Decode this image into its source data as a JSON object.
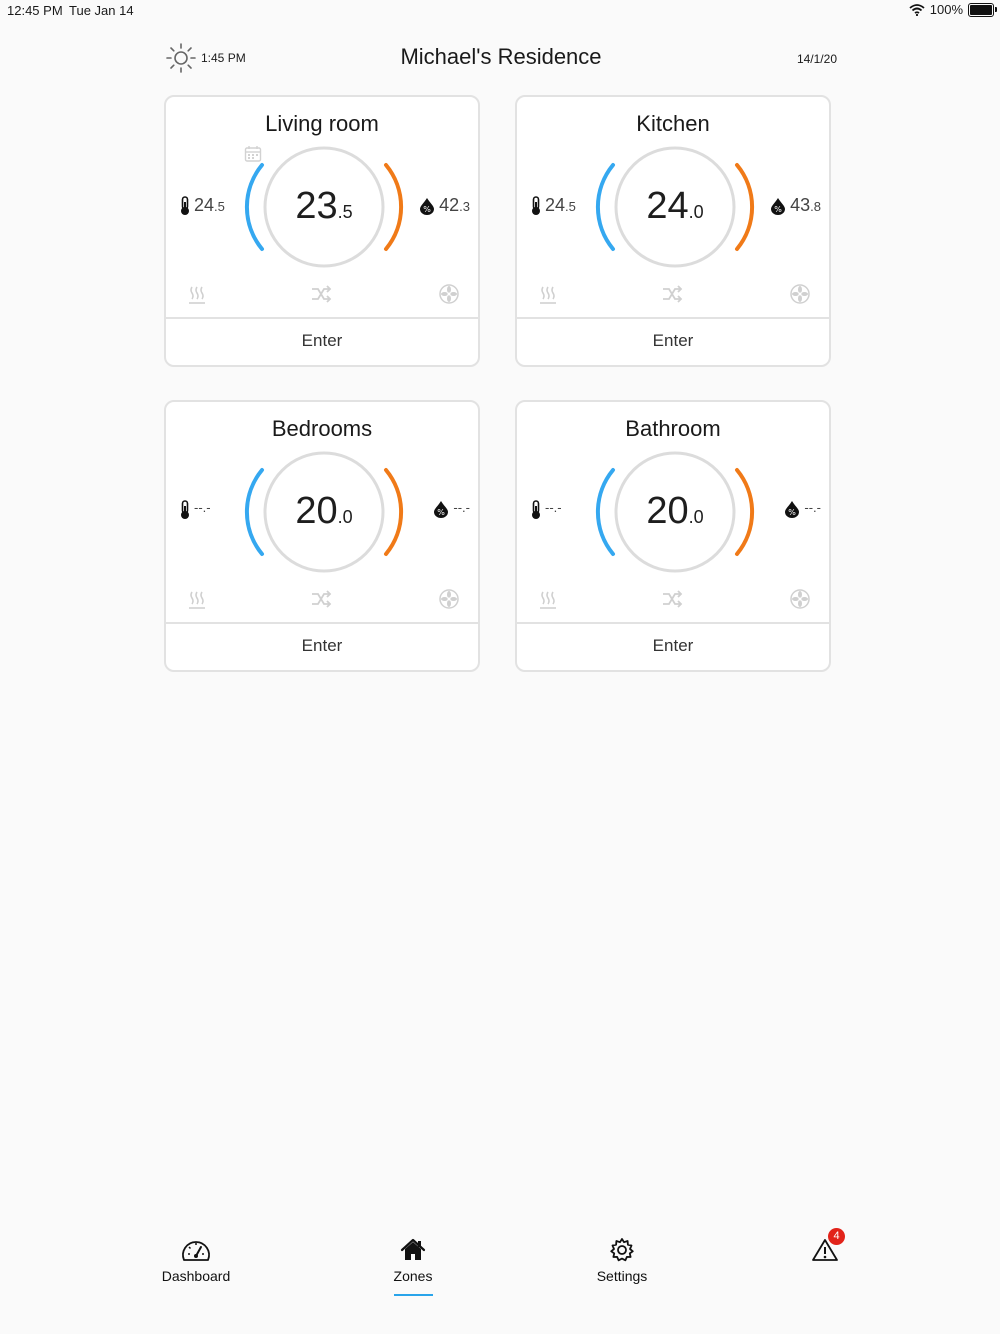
{
  "status_bar": {
    "time": "12:45 PM",
    "date": "Tue Jan 14",
    "battery": "100%"
  },
  "header": {
    "clock": "1:45 PM",
    "title": "Michael's Residence",
    "date": "14/1/20"
  },
  "zones": [
    {
      "name": "Living room",
      "temp_int": "24",
      "temp_dec": ".5",
      "set_int": "23",
      "set_dec": ".5",
      "hum_int": "42",
      "hum_dec": ".3",
      "enter": "Enter"
    },
    {
      "name": "Kitchen",
      "temp_int": "24",
      "temp_dec": ".5",
      "set_int": "24",
      "set_dec": ".0",
      "hum_int": "43",
      "hum_dec": ".8",
      "enter": "Enter"
    },
    {
      "name": "Bedrooms",
      "temp_int": "--",
      "temp_dec": ".-",
      "set_int": "20",
      "set_dec": ".0",
      "hum_int": "--",
      "hum_dec": ".-",
      "enter": "Enter"
    },
    {
      "name": "Bathroom",
      "temp_int": "--",
      "temp_dec": ".-",
      "set_int": "20",
      "set_dec": ".0",
      "hum_int": "--",
      "hum_dec": ".-",
      "enter": "Enter"
    }
  ],
  "tabs": {
    "dashboard": "Dashboard",
    "zones": "Zones",
    "settings": "Settings",
    "alert_count": "4"
  },
  "colors": {
    "cool_arc": "#35a8f0",
    "heat_arc": "#f07a18",
    "active_tab": "#29a4ea",
    "badge": "#e2231a"
  },
  "icons": [
    "sun-icon",
    "thermometer-icon",
    "humidity-icon",
    "calendar-icon",
    "radiator-icon",
    "auto-mode-icon",
    "fan-icon",
    "dashboard-icon",
    "home-icon",
    "gear-icon",
    "alert-icon"
  ]
}
